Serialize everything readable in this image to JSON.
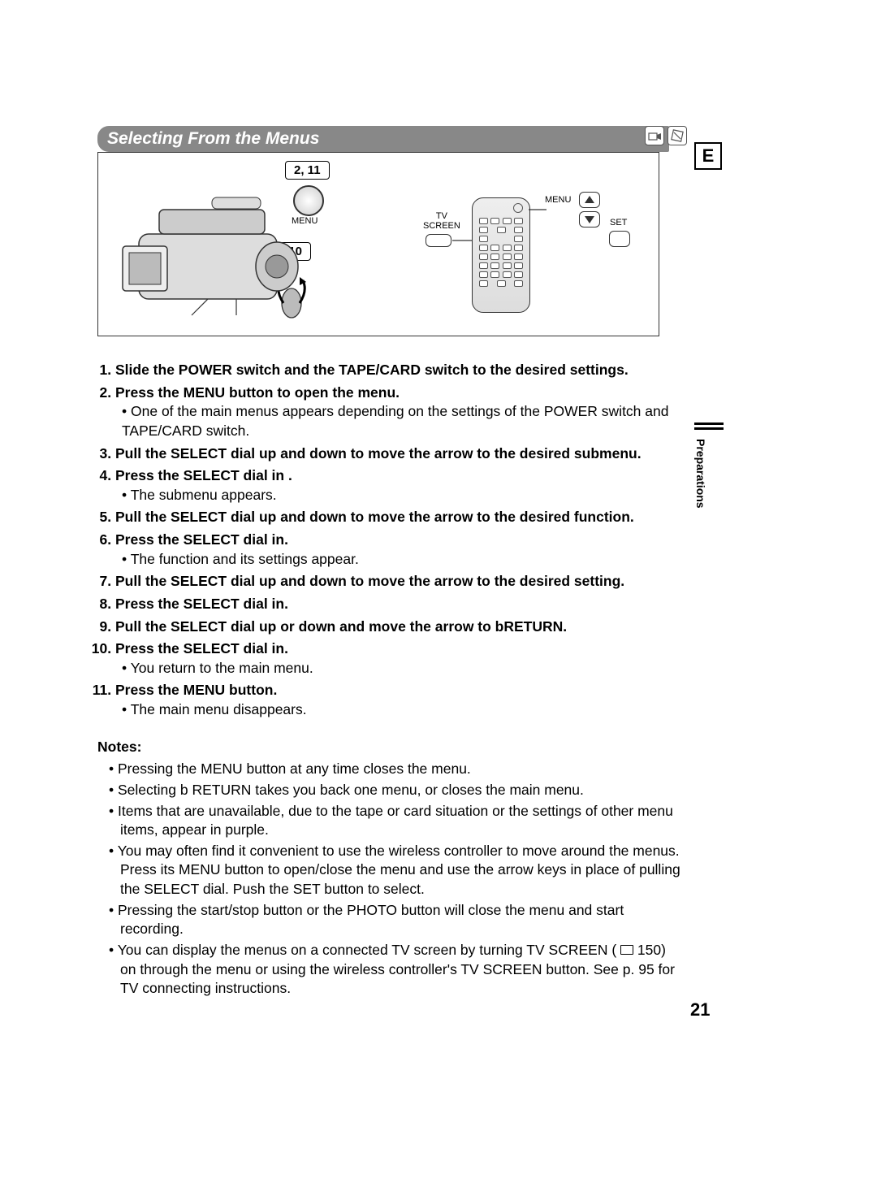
{
  "header": {
    "title": "Selecting From the Menus"
  },
  "badge": "E",
  "diagram": {
    "callout_top": "2, 11",
    "callout_mid": "3-10",
    "label_menu": "MENU",
    "label_tv_screen": "TV\nSCREEN",
    "label_menu2": "MENU",
    "label_set": "SET"
  },
  "steps": [
    {
      "text": "Slide the POWER switch and the TAPE/CARD switch to the desired settings."
    },
    {
      "text": "Press the MENU button to open the menu.",
      "sub": "One of the main menus appears depending on the settings of the POWER switch and TAPE/CARD switch."
    },
    {
      "text": "Pull the SELECT dial up and down to move the arrow to the desired submenu."
    },
    {
      "text": "Press the SELECT dial in .",
      "sub": "The submenu appears."
    },
    {
      "text": "Pull the SELECT dial up and down to move the arrow to the desired function."
    },
    {
      "text": "Press the SELECT dial in.",
      "sub": "The function and its settings appear."
    },
    {
      "text": "Pull the SELECT dial up and down to move the arrow to the desired setting."
    },
    {
      "text": "Press the SELECT dial in."
    },
    {
      "text": "Pull the SELECT dial up or down and move the arrow to bRETURN."
    },
    {
      "text": "Press the SELECT dial in.",
      "sub": "You return to the main menu."
    },
    {
      "text": "Press the MENU button.",
      "sub": "The main menu disappears."
    }
  ],
  "notes_heading": "Notes:",
  "notes": [
    "Pressing the MENU button at any time closes the menu.",
    "Selecting b  RETURN takes you back one menu, or closes the main menu.",
    "Items that are unavailable, due to the tape or card situation or the settings of other menu items, appear in purple.",
    "You may often find it convenient to use the wireless controller to move around the menus. Press its MENU button to open/close the menu and use the arrow keys in place of pulling the SELECT dial. Push the SET button to select.",
    "Pressing the start/stop button or the PHOTO button will close the menu and start recording.",
    "You can display the menus on a connected TV screen by turning TV SCREEN ( __REF__ 150) on through the menu or using the wireless controller's TV SCREEN button. See p. 95 for TV connecting instructions."
  ],
  "side_tab": "Preparations",
  "page_number": "21"
}
